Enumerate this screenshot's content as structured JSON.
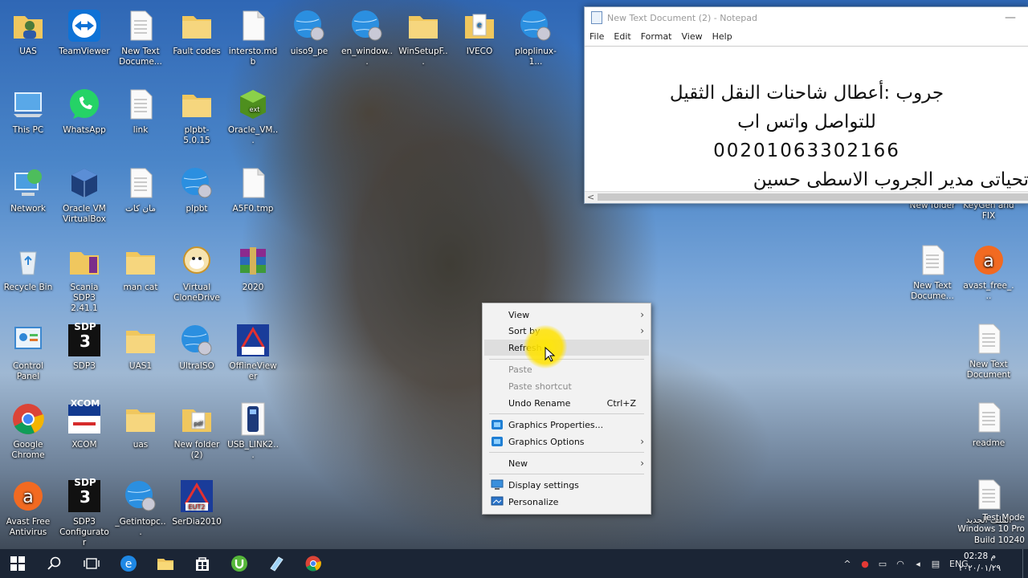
{
  "desktop_icons": [
    {
      "label": "UAS"
    },
    {
      "label": "TeamViewer"
    },
    {
      "label": "New Text Docume..."
    },
    {
      "label": "Fault codes"
    },
    {
      "label": "intersto.mdb"
    },
    {
      "label": "uiso9_pe"
    },
    {
      "label": "en_window..."
    },
    {
      "label": "WinSetupF..."
    },
    {
      "label": "IVECO"
    },
    {
      "label": "ploplinux-1..."
    },
    {
      "label": "This PC"
    },
    {
      "label": "WhatsApp"
    },
    {
      "label": "link"
    },
    {
      "label": "plpbt-5.0.15"
    },
    {
      "label": "Oracle_VM..."
    },
    {
      "label": "Network"
    },
    {
      "label": "Oracle VM VirtualBox"
    },
    {
      "label": "مان كات"
    },
    {
      "label": "plpbt"
    },
    {
      "label": "A5F0.tmp"
    },
    {
      "label": "Recycle Bin"
    },
    {
      "label": "Scania SDP3 2.41.1"
    },
    {
      "label": "man cat"
    },
    {
      "label": "Virtual CloneDrive"
    },
    {
      "label": "2020"
    },
    {
      "label": "Control Panel"
    },
    {
      "label": "SDP3"
    },
    {
      "label": "UAS1"
    },
    {
      "label": "UltraISO"
    },
    {
      "label": "OfflineViewer"
    },
    {
      "label": "Google Chrome"
    },
    {
      "label": "XCOM"
    },
    {
      "label": "uas"
    },
    {
      "label": "New folder (2)"
    },
    {
      "label": "USB_LINK2..."
    },
    {
      "label": "Avast Free Antivirus"
    },
    {
      "label": "SDP3 Configurator"
    },
    {
      "label": "_Getintopc..."
    },
    {
      "label": "SerDia2010"
    },
    {
      "label": "New folder"
    },
    {
      "label": "KeyGen and FIX"
    },
    {
      "label": "New Text Docume..."
    },
    {
      "label": "avast_free_..."
    },
    {
      "label": "New Text Document"
    },
    {
      "label": "readme"
    },
    {
      "label": "الملف الجديد"
    }
  ],
  "icon_badges": {
    "sdp": "SDP",
    "sdp_num": "3",
    "xcom": "XCOM",
    "eut": "EUT2",
    "ext": "ext",
    "pdf": "pdf"
  },
  "notepad": {
    "title": "New Text Document (2) - Notepad",
    "minimize": "—",
    "menu": [
      "File",
      "Edit",
      "Format",
      "View",
      "Help"
    ],
    "lines": [
      "جروب :أعطال شاحنات النقل الثقيل",
      "للتواصل واتس اب",
      "00201063302166",
      "تحياتى مدير الجروب الاسطى حسين"
    ],
    "scroll_left": "<"
  },
  "context_menu": {
    "view": "View",
    "sort_by": "Sort by",
    "refresh": "Refresh",
    "paste": "Paste",
    "paste_shortcut": "Paste shortcut",
    "undo_rename": "Undo Rename",
    "undo_rename_shortcut": "Ctrl+Z",
    "graphics_properties": "Graphics Properties...",
    "graphics_options": "Graphics Options",
    "new": "New",
    "display_settings": "Display settings",
    "personalize": "Personalize",
    "chevron": "›"
  },
  "watermark": {
    "line1": "Test Mode",
    "line2": "Windows 10 Pro",
    "line3": "Build 10240"
  },
  "taskbar": {
    "language": "ENG",
    "time": "02:28 م",
    "date": "٢٠٢٠/٠١/٢٩",
    "tray_up": "^"
  },
  "colors": {
    "folder": "#f0c75e",
    "taskbar": "#1b2535",
    "accent_blue": "#0a7bd6",
    "highlight_yellow": "#ffe400"
  }
}
